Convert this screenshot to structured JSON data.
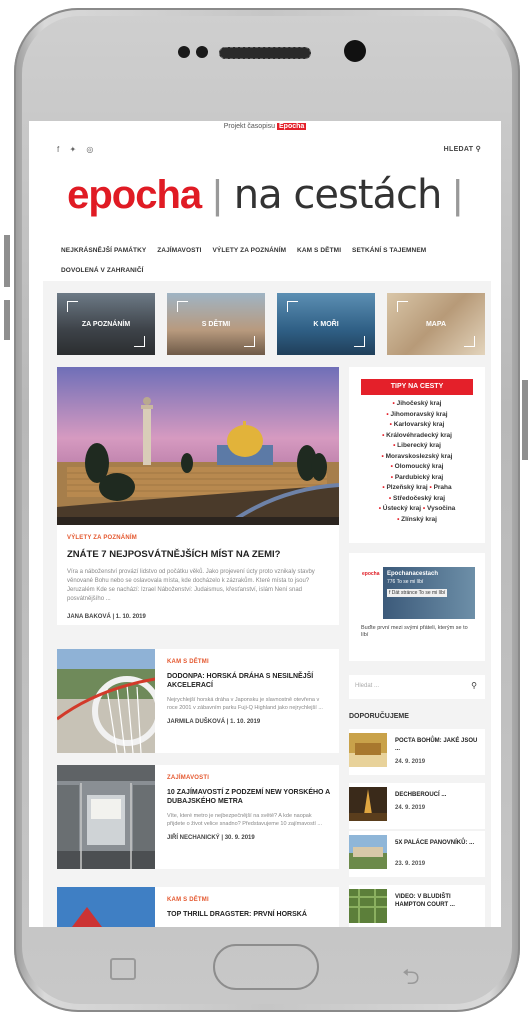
{
  "promo": {
    "text": "Projekt časopisu",
    "badge": "Epocha"
  },
  "social": {
    "facebook": "f",
    "twitter": "♥",
    "instagram": "◎"
  },
  "search_link": "HLEDAT",
  "logo": {
    "left": "epocha",
    "right": "na cestách"
  },
  "menu": [
    "NEJKRÁSNĚJŠÍ PAMÁTKY",
    "ZAJÍMAVOSTI",
    "VÝLETY ZA POZNÁNÍM",
    "KAM S DĚTMI",
    "SETKÁNÍ S TAJEMNEM",
    "DOVOLENÁ V ZAHRANIČÍ"
  ],
  "categories": [
    "ZA POZNÁNÍM",
    "S DĚTMI",
    "K MOŘI",
    "MAPA"
  ],
  "hero": {
    "kicker": "VÝLETY ZA POZNÁNÍM",
    "title": "ZNÁTE 7 NEJPOSVÁTNĚJŠÍCH MÍST NA ZEMI?",
    "excerpt": "Víra a náboženství provází lidstvo od počátku věků. Jako projevení úcty proto vznikaly stavby věnované Bohu nebo se oslavovala místa, kde docházelo k zázrakům. Které místa to jsou? Jeruzalém Kde se nachází: Izrael Náboženství: Judaismus, křesťanství, islám Není snad posvátnějšího ...",
    "author": "JANA BAKOVÁ",
    "date": "1. 10. 2019"
  },
  "articles": [
    {
      "kicker": "KAM S DĚTMI",
      "title": "DODONPA: HORSKÁ DRÁHA S NESILNĚJŠÍ AKCELERACÍ",
      "excerpt": "Nejrychlejší horská dráha v Japonsku je slavnostně otevřena v roce 2001 v zábavním parku Fuji-Q Highland jako nejrychlejší ...",
      "author": "JARMILA DUŠKOVÁ",
      "date": "1. 10. 2019"
    },
    {
      "kicker": "ZAJÍMAVOSTI",
      "title": "10 ZAJÍMAVOSTÍ Z PODZEMÍ NEW YORSKÉHO A DUBAJSKÉHO METRA",
      "excerpt": "Víte, které metro je nejbezpečnější na světě? A kde naopak přijdete o život velice snadno? Představujeme 10 zajímavostí ...",
      "author": "JIŘÍ NECHANICKÝ",
      "date": "30. 9. 2019"
    },
    {
      "kicker": "KAM S DĚTMI",
      "title": "TOP THRILL DRAGSTER: PRVNÍ HORSKÁ",
      "excerpt": "",
      "author": "",
      "date": ""
    }
  ],
  "tipy": {
    "heading": "TIPY NA CESTY",
    "regions": [
      "Jihočeský kraj",
      "Jihomoravský kraj",
      "Karlovarský kraj",
      "Královéhradecký kraj",
      "Liberecký kraj",
      "Moravskoslezský kraj",
      "Olomoucký kraj",
      "Pardubický kraj",
      "Plzeňský kraj",
      "Praha",
      "Středočeský kraj",
      "Ústecký kraj",
      "Vysočina",
      "Zlínský kraj"
    ]
  },
  "fb": {
    "logo": "epocha",
    "page_name": "Epochanacestach",
    "likes": "776 To se mi líbí",
    "button": "Dát stránce To se mi líbí",
    "note": "Buďte první mezi svými přáteli, kterým se to líbí"
  },
  "sidebar_search": {
    "placeholder": "Hledat ..."
  },
  "recommended": {
    "heading": "DOPORUČUJEME",
    "items": [
      {
        "title": "POCTA BOHŮM: JAKÉ JSOU ...",
        "date": "24. 9. 2019"
      },
      {
        "title": "DECHBEROUCÍ ...",
        "date": "24. 9. 2019"
      },
      {
        "title": "5X PALÁCE PANOVNÍKŮ: ...",
        "date": "23. 9. 2019"
      },
      {
        "title": "VIDEO: V BLUDIŠTI HAMPTON COURT ...",
        "date": ""
      }
    ]
  },
  "colors": {
    "accent": "#e4202a",
    "kicker": "#e4572e"
  }
}
